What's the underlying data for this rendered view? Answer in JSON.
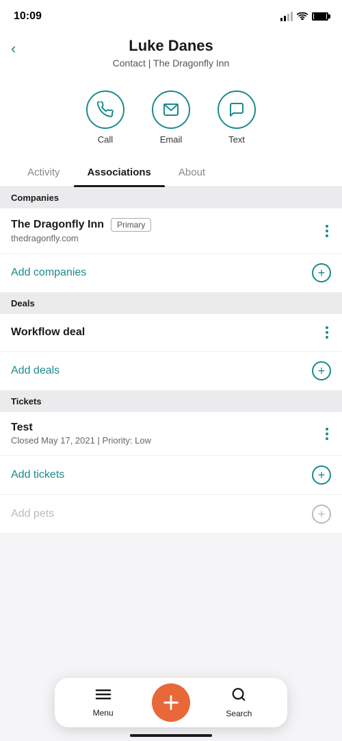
{
  "statusBar": {
    "time": "10:09"
  },
  "header": {
    "contactName": "Luke Danes",
    "subtitle": "Contact | The Dragonfly Inn",
    "backLabel": "<"
  },
  "actionButtons": [
    {
      "id": "call",
      "label": "Call"
    },
    {
      "id": "email",
      "label": "Email"
    },
    {
      "id": "text",
      "label": "Text"
    }
  ],
  "tabs": [
    {
      "id": "activity",
      "label": "Activity",
      "active": false
    },
    {
      "id": "associations",
      "label": "Associations",
      "active": true
    },
    {
      "id": "about",
      "label": "About",
      "active": false
    }
  ],
  "sections": {
    "companies": {
      "header": "Companies",
      "items": [
        {
          "name": "The Dragonfly Inn",
          "badge": "Primary",
          "subtitle": "thedragonfly.com"
        }
      ],
      "addLabel": "Add companies"
    },
    "deals": {
      "header": "Deals",
      "items": [
        {
          "name": "Workflow deal",
          "subtitle": ""
        }
      ],
      "addLabel": "Add deals"
    },
    "tickets": {
      "header": "Tickets",
      "items": [
        {
          "name": "Test",
          "subtitle": "Closed May 17, 2021 | Priority: Low"
        }
      ],
      "addLabel": "Add tickets"
    },
    "pets": {
      "addLabel": "Add pets",
      "disabled": true
    }
  },
  "bottomNav": {
    "menuLabel": "Menu",
    "searchLabel": "Search"
  }
}
